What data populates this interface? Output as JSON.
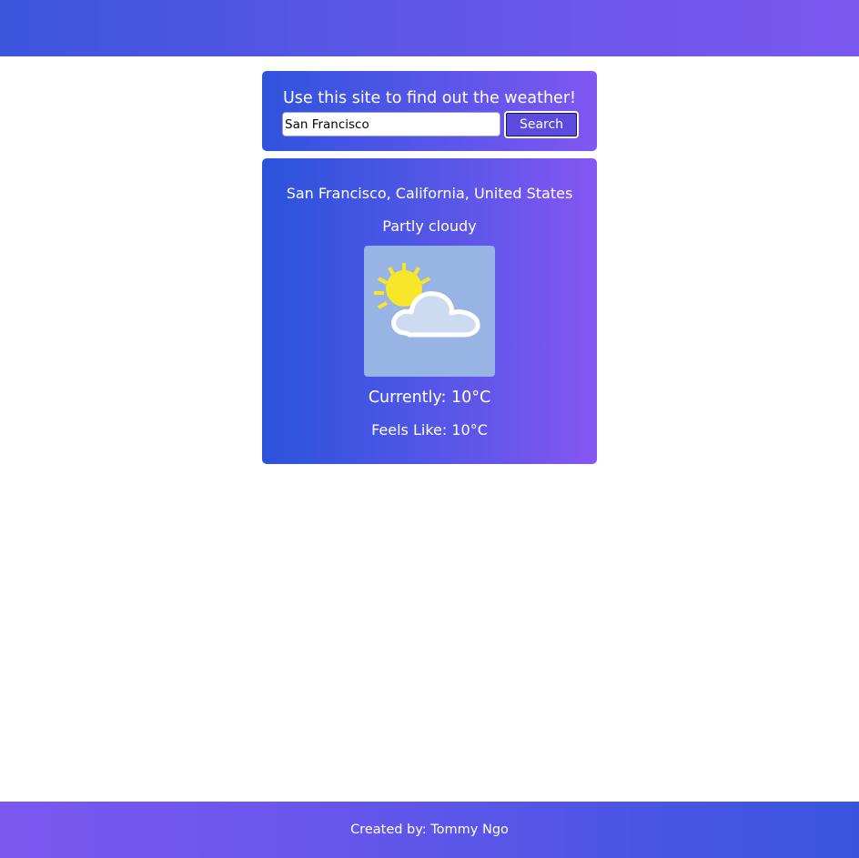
{
  "search": {
    "heading": "Use this site to find out the weather!",
    "input_value": "San Francisco",
    "button_label": "Search"
  },
  "weather": {
    "location": "San Francisco, California, United States",
    "condition": "Partly cloudy",
    "icon": "partly-cloudy-icon",
    "current": "Currently: 10°C",
    "feels_like": "Feels Like: 10°C"
  },
  "footer": {
    "credit": "Created by: Tommy Ngo"
  },
  "colors": {
    "accent_start": "#3b55dd",
    "accent_end": "#7a58f0",
    "icon_background": "#98b4e4",
    "sun": "#f7e62a"
  }
}
